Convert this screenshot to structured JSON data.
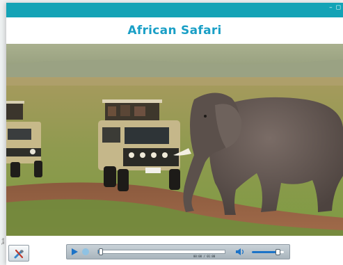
{
  "window": {
    "controls": "– ◻"
  },
  "header": {
    "title": "African Safari"
  },
  "photo": {
    "subject": "safari-elephant-photo"
  },
  "player": {
    "time": "00:00 / 01:00",
    "progress": 0.02,
    "volume": 0.82
  },
  "toolbar": {
    "tool_icon": "tools-icon",
    "side_label": "Tools"
  },
  "colors": {
    "titlebar": "#14a3b6",
    "title_text": "#1a9fc6",
    "accent": "#1c73c7"
  }
}
